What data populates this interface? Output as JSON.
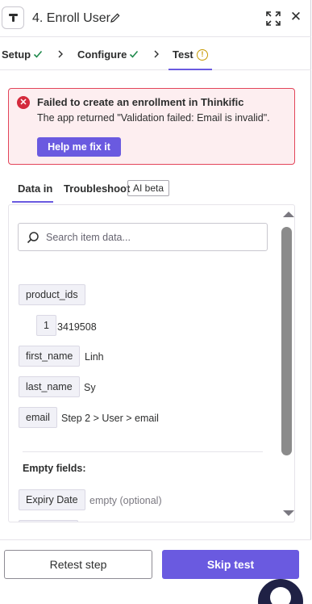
{
  "header": {
    "title": "4. Enroll User",
    "close_glyph": "✕"
  },
  "steps": [
    {
      "label": "Setup",
      "status": "complete"
    },
    {
      "label": "Configure",
      "status": "complete"
    },
    {
      "label": "Test",
      "status": "warning",
      "active": true
    }
  ],
  "error": {
    "title": "Failed to create an enrollment in Thinkific",
    "message": "The app returned \"Validation failed: Email is invalid\".",
    "fix_button": "Help me fix it",
    "icon_glyph": "✕"
  },
  "tabs": {
    "data_in": "Data in",
    "troubleshoot": "Troubleshoot",
    "ai_badge": "AI beta"
  },
  "search": {
    "placeholder": "Search item data..."
  },
  "data_fields": [
    {
      "key": "product_ids",
      "value": ""
    },
    {
      "key": "1",
      "value": "3419508",
      "nested": true
    },
    {
      "key": "first_name",
      "value": "Linh"
    },
    {
      "key": "last_name",
      "value": "Sy"
    },
    {
      "key": "email",
      "value": "Step 2 > User > email"
    }
  ],
  "empty_fields": {
    "label": "Empty fields:",
    "items": [
      {
        "key": "Expiry Date",
        "value": "empty (optional)"
      }
    ]
  },
  "footer": {
    "retest": "Retest step",
    "skip": "Skip test"
  },
  "colors": {
    "accent": "#6a5ae0",
    "error_border": "#e3455a",
    "error_bg": "#fdeef0",
    "success": "#1f8a4c",
    "warning": "#c79a00"
  }
}
